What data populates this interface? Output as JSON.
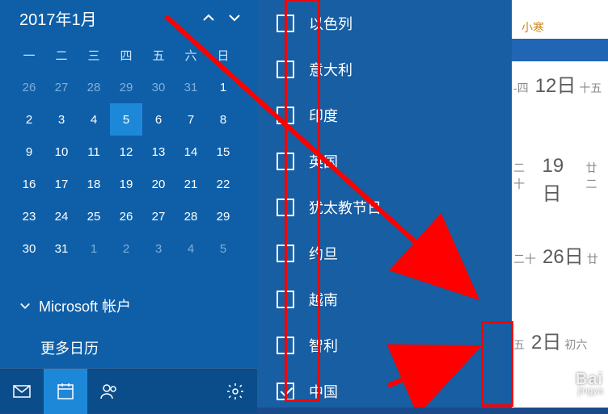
{
  "header": {
    "title": "2017年1月"
  },
  "weekdays": [
    "一",
    "二",
    "三",
    "四",
    "五",
    "六",
    "日"
  ],
  "days": [
    {
      "n": "26",
      "dim": true
    },
    {
      "n": "27",
      "dim": true
    },
    {
      "n": "28",
      "dim": true
    },
    {
      "n": "29",
      "dim": true
    },
    {
      "n": "30",
      "dim": true
    },
    {
      "n": "31",
      "dim": true
    },
    {
      "n": "1",
      "dim": false
    },
    {
      "n": "2"
    },
    {
      "n": "3"
    },
    {
      "n": "4"
    },
    {
      "n": "5",
      "sel": true
    },
    {
      "n": "6"
    },
    {
      "n": "7"
    },
    {
      "n": "8"
    },
    {
      "n": "9"
    },
    {
      "n": "10"
    },
    {
      "n": "11"
    },
    {
      "n": "12"
    },
    {
      "n": "13"
    },
    {
      "n": "14"
    },
    {
      "n": "15"
    },
    {
      "n": "16"
    },
    {
      "n": "17"
    },
    {
      "n": "18"
    },
    {
      "n": "19"
    },
    {
      "n": "20"
    },
    {
      "n": "21"
    },
    {
      "n": "22"
    },
    {
      "n": "23"
    },
    {
      "n": "24"
    },
    {
      "n": "25"
    },
    {
      "n": "26"
    },
    {
      "n": "27"
    },
    {
      "n": "28"
    },
    {
      "n": "29"
    },
    {
      "n": "30"
    },
    {
      "n": "31"
    },
    {
      "n": "1",
      "dim": true
    },
    {
      "n": "2",
      "dim": true
    },
    {
      "n": "3",
      "dim": true
    },
    {
      "n": "4",
      "dim": true
    },
    {
      "n": "5",
      "dim": true
    }
  ],
  "accounts": {
    "microsoft": "Microsoft 帐户",
    "more": "更多日历"
  },
  "holidays": [
    {
      "label": "以色列",
      "checked": false
    },
    {
      "label": "意大利",
      "checked": false
    },
    {
      "label": "印度",
      "checked": false
    },
    {
      "label": "英国",
      "checked": false
    },
    {
      "label": "犹太教节日",
      "checked": false
    },
    {
      "label": "约旦",
      "checked": false
    },
    {
      "label": "越南",
      "checked": false
    },
    {
      "label": "智利",
      "checked": false
    },
    {
      "label": "中国",
      "checked": true
    }
  ],
  "right": {
    "solar_term": "小寒",
    "rows": [
      {
        "pre": "-四",
        "num": "12日",
        "lunar": "十五"
      },
      {
        "pre": "二十",
        "num": "19日",
        "lunar": "廿二"
      },
      {
        "pre": "二十",
        "num": "26日",
        "lunar": "廿"
      },
      {
        "pre": "五",
        "num": "2日",
        "lunar": "初六"
      }
    ]
  },
  "watermark": {
    "brand": "Bai",
    "sub": "jingya"
  }
}
